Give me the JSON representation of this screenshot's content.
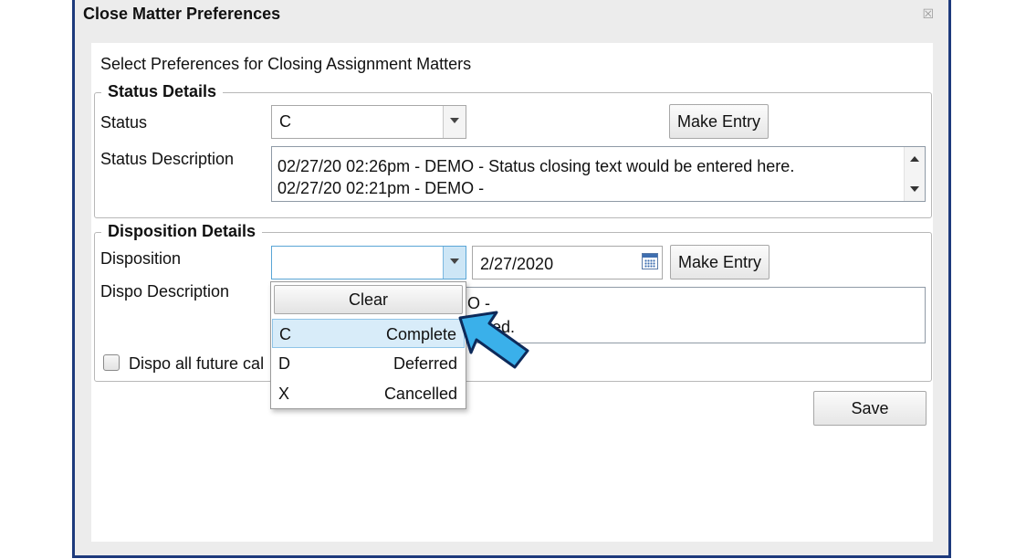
{
  "window": {
    "title": "Close Matter Preferences",
    "close_symbol": "☒"
  },
  "intro": "Select Preferences for Closing Assignment Matters",
  "status_group": {
    "legend": "Status Details",
    "status_label": "Status",
    "status_value": "C",
    "make_entry_label": "Make Entry",
    "description_label": "Status Description",
    "description_lines": [
      "02/27/20 02:26pm - DEMO - Status closing text would be entered here.",
      "02/27/20 02:21pm - DEMO -"
    ]
  },
  "disposition_group": {
    "legend": "Disposition Details",
    "disposition_label": "Disposition",
    "disposition_value": "",
    "date_value": "2/27/2020",
    "make_entry_label": "Make Entry",
    "dispo_description_label": "Dispo Description",
    "dispo_description_visible_fragments": [
      "O -",
      "ed."
    ],
    "future_checkbox_label": "Dispo all future cal",
    "future_checkbox_checked": false
  },
  "disposition_dropdown": {
    "clear_label": "Clear",
    "options": [
      {
        "code": "C",
        "name": "Complete",
        "highlighted": true
      },
      {
        "code": "D",
        "name": "Deferred",
        "highlighted": false
      },
      {
        "code": "X",
        "name": "Cancelled",
        "highlighted": false
      }
    ]
  },
  "save_label": "Save",
  "colors": {
    "frame": "#1d3a7c",
    "highlight": "#d8ecf9",
    "pointer": "#3ab0ea"
  }
}
